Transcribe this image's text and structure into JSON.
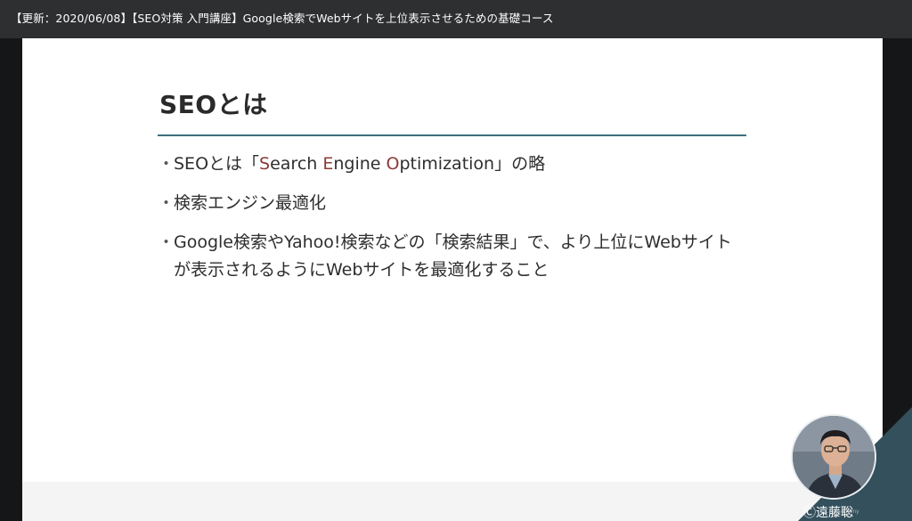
{
  "header": {
    "title": "【更新：2020/06/08】【SEO対策 入門講座】Google検索でWebサイトを上位表示させるための基礎コース"
  },
  "slide": {
    "heading": "SEOとは",
    "bullets": {
      "b1": {
        "prefix": "SEOとは「",
        "s": "S",
        "s_rest": "earch ",
        "e": "E",
        "e_rest": "ngine ",
        "o": "O",
        "o_rest": "ptimization",
        "suffix": "」の略"
      },
      "b2": "検索エンジン最適化",
      "b3": "Google検索やYahoo!検索などの「検索結果」で、より上位にWebサイトが表示されるようにWebサイトを最適化すること"
    },
    "bullet_marker": "・"
  },
  "presenter": {
    "caption": "Ⓒ遠藤聡",
    "watermark": "udemy"
  },
  "colors": {
    "topbar": "#2d2f31",
    "accent_rule": "#3f6f7d",
    "highlight_letter": "#8b3a36",
    "corner_triangle": "#33505c"
  }
}
